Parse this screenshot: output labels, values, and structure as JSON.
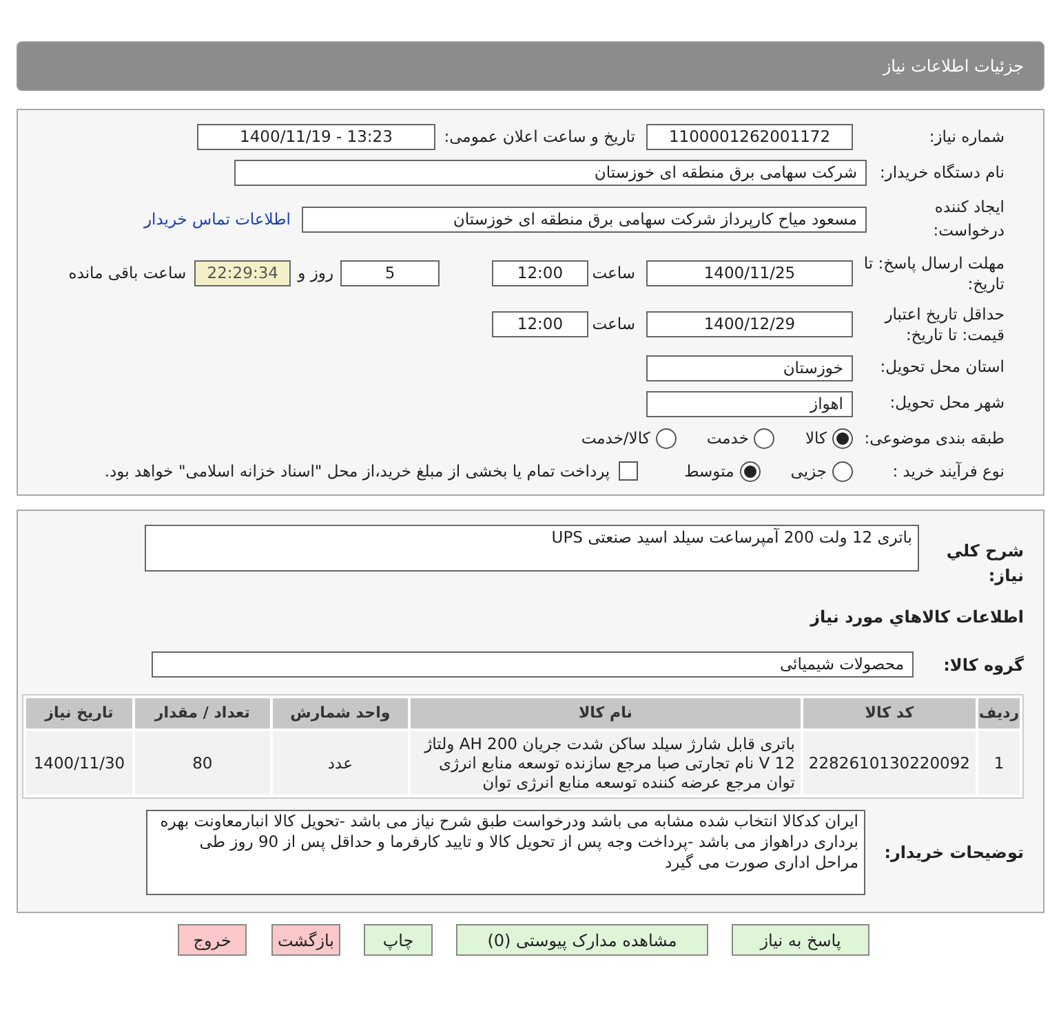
{
  "header": {
    "title": "جزئیات اطلاعات نیاز"
  },
  "form": {
    "need_number": {
      "label": "شماره نیاز:",
      "value": "1100001262001172"
    },
    "announce": {
      "label": "تاریخ و ساعت اعلان عمومی:",
      "value": "1400/11/19 - 13:23"
    },
    "buyer_org": {
      "label": "نام دستگاه خریدار:",
      "value": "شرکت سهامی برق منطقه ای خوزستان"
    },
    "requester": {
      "label": "ایجاد کننده درخواست:",
      "value": "مسعود میاح کارپرداز شرکت سهامی برق منطقه ای خوزستان",
      "link": "اطلاعات تماس خریدار"
    },
    "deadline": {
      "label": "مهلت ارسال پاسخ: تا تاریخ:",
      "date": "1400/11/25",
      "time_label": "ساعت",
      "time": "12:00",
      "days": "5",
      "days_label": "روز و",
      "remaining": "22:29:34",
      "remaining_label": "ساعت باقی مانده"
    },
    "validity": {
      "label": "حداقل تاریخ اعتبار قیمت: تا تاریخ:",
      "date": "1400/12/29",
      "time_label": "ساعت",
      "time": "12:00"
    },
    "province": {
      "label": "استان محل تحویل:",
      "value": "خوزستان"
    },
    "city": {
      "label": "شهر محل تحویل:",
      "value": "اهواز"
    },
    "category": {
      "label": "طبقه بندی موضوعی:",
      "options": [
        {
          "label": "کالا",
          "selected": true
        },
        {
          "label": "خدمت",
          "selected": false
        },
        {
          "label": "کالا/خدمت",
          "selected": false
        }
      ]
    },
    "process": {
      "label": "نوع فرآیند خرید :",
      "options": [
        {
          "label": "جزیی",
          "selected": false
        },
        {
          "label": "متوسط",
          "selected": true
        }
      ],
      "treasury": {
        "label": "پرداخت تمام یا بخشی از مبلغ خرید،از محل \"اسناد خزانه اسلامی\" خواهد بود.",
        "checked": false
      }
    }
  },
  "details": {
    "description": {
      "label": "شرح کلي نياز:",
      "value": "باتری 12 ولت 200 آمپرساعت سیلد اسید صنعتی UPS"
    },
    "goods_heading": "اطلاعات کالاهاي مورد نياز",
    "group": {
      "label": "گروه کالا:",
      "value": "محصولات شیمیائی"
    },
    "table": {
      "columns": [
        "ردیف",
        "کد کالا",
        "نام کالا",
        "واحد شمارش",
        "تعداد / مقدار",
        "تاریخ نیاز"
      ],
      "rows": [
        [
          "1",
          "2282610130220092",
          "باتری قابل شارژ سیلد ساکن شدت جریان 200 AH ولتاژ 12 V نام تجارتی صبا مرجع سازنده توسعه منابع انرژی توان مرجع عرضه کننده توسعه منابع انرژی توان",
          "عدد",
          "80",
          "1400/11/30"
        ]
      ]
    },
    "notes": {
      "label": "توضیحات خریدار:",
      "value": "ایران کدکالا انتخاب شده مشابه می باشد ودرخواست طبق شرح نیاز می  باشد -تحویل کالا انبارمعاونت بهره برداری دراهواز می باشد -پرداخت وجه پس از تحویل کالا و تایید کارفرما و حداقل پس از 90 روز طی مراحل اداری صورت می گیرد"
    }
  },
  "buttons": [
    {
      "label": "پاسخ به نیاز",
      "kind": "primary"
    },
    {
      "label": "مشاهده مدارک پیوستی (0)",
      "kind": "primary"
    },
    {
      "label": "چاپ",
      "kind": "primary"
    },
    {
      "label": "بازگشت",
      "kind": "danger"
    },
    {
      "label": "خروج",
      "kind": "danger"
    }
  ]
}
